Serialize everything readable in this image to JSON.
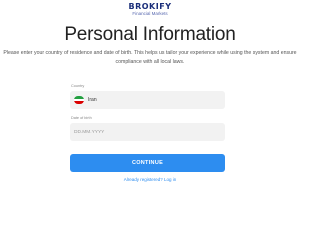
{
  "brand": {
    "name": "BROKIFY",
    "tagline": "Financial Markets",
    "color": "#1a2e7a"
  },
  "header": {
    "title": "Personal Information",
    "description": "Please enter your country of residence and date of birth. This helps us tailor your experience while using the system and ensure compliance with all local laws."
  },
  "form": {
    "country": {
      "label": "Country",
      "value": "Iran",
      "flag_icon": "iran-flag-icon"
    },
    "dob": {
      "label": "Date of birth",
      "placeholder": "DD.MM.YYYY",
      "value": ""
    },
    "continue_label": "CONTINUE",
    "login_link": "Already registered? Log in"
  },
  "colors": {
    "accent": "#2d8df0",
    "field_bg": "#f2f2f2"
  }
}
